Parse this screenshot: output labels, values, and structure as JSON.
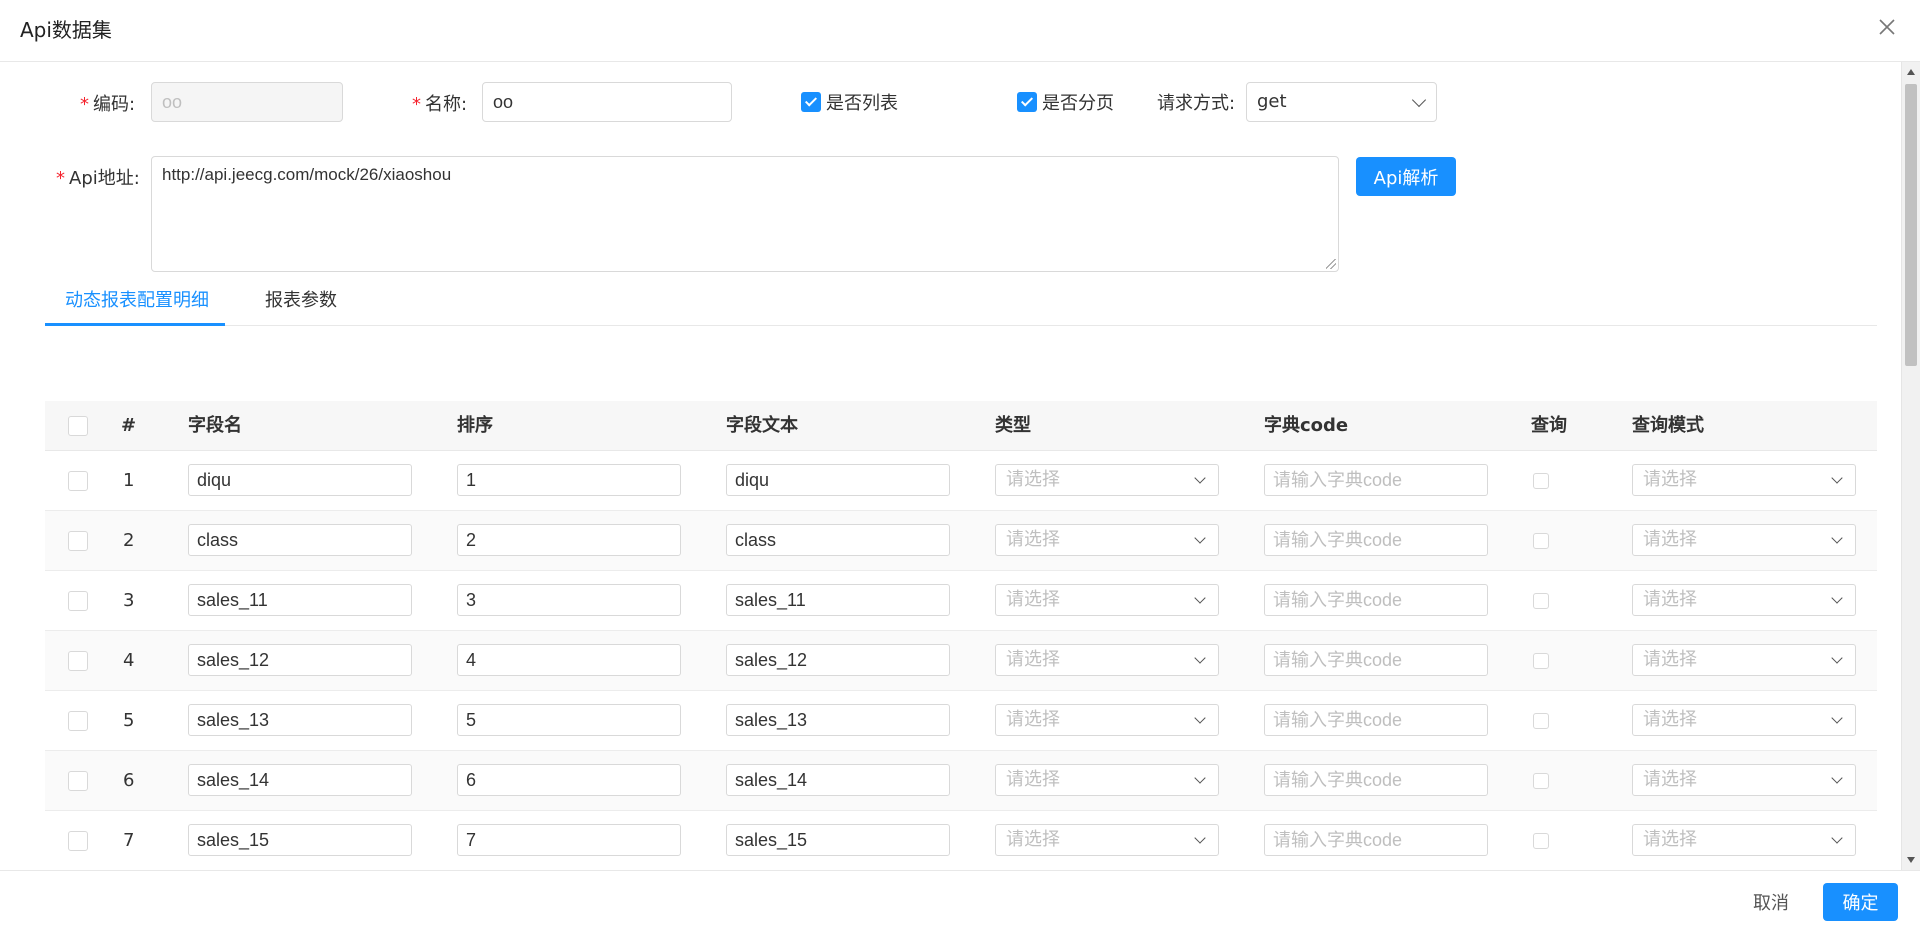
{
  "dialog": {
    "title": "Api数据集"
  },
  "form": {
    "code": {
      "label": "编码:",
      "value": "oo"
    },
    "name": {
      "label": "名称:",
      "value": "oo"
    },
    "is_list": {
      "label": "是否列表",
      "checked": true
    },
    "is_paged": {
      "label": "是否分页",
      "checked": true
    },
    "method": {
      "label": "请求方式:",
      "value": "get"
    },
    "api_url": {
      "label": "Api地址:",
      "value": "http://api.jeecg.com/mock/26/xiaoshou"
    },
    "parse_button": "Api解析"
  },
  "tabs": [
    {
      "label": "动态报表配置明细",
      "active": true
    },
    {
      "label": "报表参数",
      "active": false
    }
  ],
  "table": {
    "columns": [
      "#",
      "字段名",
      "排序",
      "字段文本",
      "类型",
      "字典code",
      "查询",
      "查询模式"
    ],
    "type_placeholder": "请选择",
    "dict_placeholder": "请输入字典code",
    "mode_placeholder": "请选择",
    "rows": [
      {
        "num": "1",
        "field": "diqu",
        "order": "1",
        "text": "diqu"
      },
      {
        "num": "2",
        "field": "class",
        "order": "2",
        "text": "class"
      },
      {
        "num": "3",
        "field": "sales_11",
        "order": "3",
        "text": "sales_11"
      },
      {
        "num": "4",
        "field": "sales_12",
        "order": "4",
        "text": "sales_12"
      },
      {
        "num": "5",
        "field": "sales_13",
        "order": "5",
        "text": "sales_13"
      },
      {
        "num": "6",
        "field": "sales_14",
        "order": "6",
        "text": "sales_14"
      },
      {
        "num": "7",
        "field": "sales_15",
        "order": "7",
        "text": "sales_15"
      }
    ]
  },
  "footer": {
    "cancel": "取消",
    "confirm": "确定"
  },
  "colors": {
    "primary": "#1890ff",
    "required": "#f5222d"
  }
}
